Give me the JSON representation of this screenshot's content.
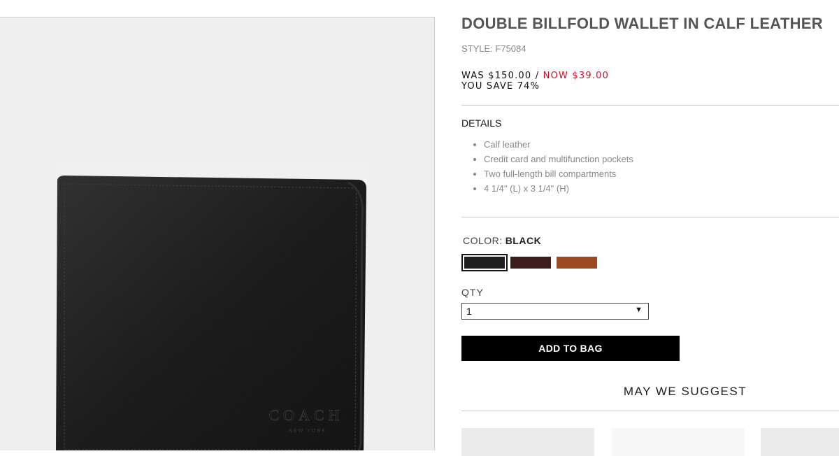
{
  "product": {
    "title": "DOUBLE BILLFOLD WALLET IN CALF LEATHER",
    "style": "STYLE: F75084",
    "price_was": "WAS $150.00",
    "price_separator": " / ",
    "price_now": "NOW $39.00",
    "you_save": "YOU SAVE 74%",
    "image_brand": "COACH",
    "image_sub": "NEW YORK"
  },
  "details": {
    "heading": "DETAILS",
    "items": [
      "Calf leather",
      "Credit card and multifunction pockets",
      "Two full-length bill compartments",
      "4 1/4\" (L) x 3 1/4\" (H)"
    ]
  },
  "color": {
    "label": "COLOR:",
    "selected": "BLACK",
    "swatches": [
      {
        "name": "black",
        "hex": "#1e1e1e"
      },
      {
        "name": "brown",
        "hex": "#3b1e1c"
      },
      {
        "name": "saddle",
        "hex": "#9c4a22"
      }
    ]
  },
  "qty": {
    "label": "QTY",
    "value": "1",
    "arrow": "▼"
  },
  "add_to_bag": "ADD TO BAG",
  "suggest_heading": "MAY WE SUGGEST"
}
